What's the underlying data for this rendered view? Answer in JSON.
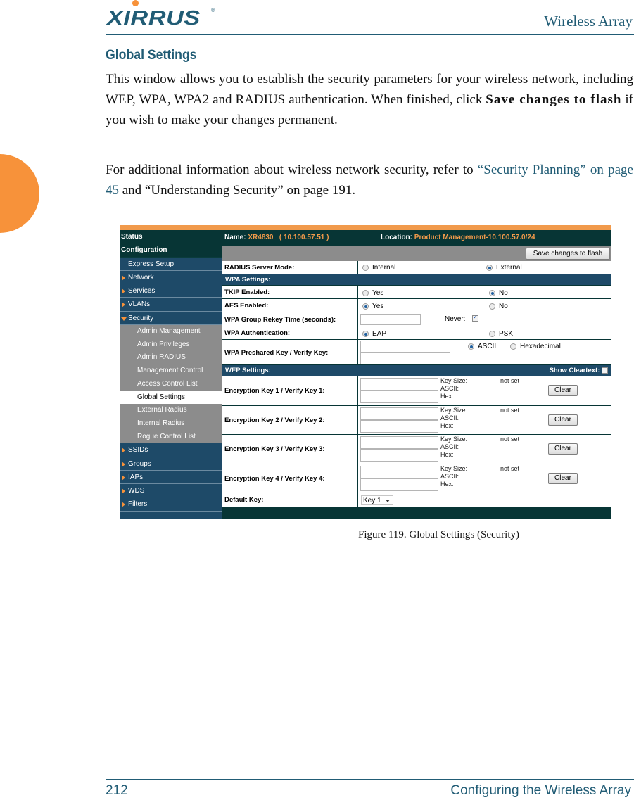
{
  "header": {
    "logo_text": "XIRRUS",
    "logo_reg": "®",
    "title": "Wireless Array"
  },
  "section": {
    "title": "Global Settings",
    "para1_a": "This window allows you to establish the security parameters for your wireless network, including WEP, WPA, WPA2 and RADIUS authentication. When finished, click ",
    "para1_bold": "Save changes to flash",
    "para1_b": " if you wish to make your changes permanent.",
    "para2_a": "For additional information about wireless network security, refer to ",
    "para2_link": "“Security Planning” on page 45",
    "para2_b": " and “Understanding Security” on page 191."
  },
  "screenshot": {
    "sidebar": {
      "status": "Status",
      "configuration": "Configuration",
      "items": [
        {
          "label": "Express Setup",
          "type": "plain"
        },
        {
          "label": "Network",
          "type": "collapsed"
        },
        {
          "label": "Services",
          "type": "collapsed"
        },
        {
          "label": "VLANs",
          "type": "collapsed"
        },
        {
          "label": "Security",
          "type": "expanded"
        }
      ],
      "security_sub": [
        {
          "label": "Admin Management",
          "active": false
        },
        {
          "label": "Admin Privileges",
          "active": false
        },
        {
          "label": "Admin RADIUS",
          "active": false
        },
        {
          "label": "Management Control",
          "active": false
        },
        {
          "label": "Access Control List",
          "active": false
        },
        {
          "label": "Global Settings",
          "active": true
        },
        {
          "label": "External Radius",
          "active": false
        },
        {
          "label": "Internal Radius",
          "active": false
        },
        {
          "label": "Rogue Control List",
          "active": false
        }
      ],
      "items_after": [
        {
          "label": "SSIDs"
        },
        {
          "label": "Groups"
        },
        {
          "label": "IAPs"
        },
        {
          "label": "WDS"
        },
        {
          "label": "Filters"
        }
      ]
    },
    "head": {
      "name_label": "Name:",
      "name_value": "XR4830",
      "ip": "( 10.100.57.51 )",
      "location_label": "Location:",
      "location_value": "Product Management-10.100.57.0/24"
    },
    "save_button": "Save changes to flash",
    "radius_mode": {
      "label": "RADIUS Server Mode:",
      "options": [
        "Internal",
        "External"
      ],
      "selected": "External"
    },
    "wpa_section": "WPA Settings:",
    "tkip": {
      "label": "TKIP Enabled:",
      "options": [
        "Yes",
        "No"
      ],
      "selected": "No"
    },
    "aes": {
      "label": "AES Enabled:",
      "options": [
        "Yes",
        "No"
      ],
      "selected": "Yes"
    },
    "rekey": {
      "label": "WPA Group Rekey Time (seconds):",
      "value": "",
      "never_label": "Never:",
      "never_checked": true
    },
    "wpa_auth": {
      "label": "WPA Authentication:",
      "options": [
        "EAP",
        "PSK"
      ],
      "selected": "EAP"
    },
    "psk": {
      "label": "WPA Preshared Key / Verify Key:",
      "key": "",
      "verify": "",
      "options": [
        "ASCII",
        "Hexadecimal"
      ],
      "selected": "ASCII"
    },
    "wep_section": "WEP Settings:",
    "show_cleartext": {
      "label": "Show Cleartext:",
      "checked": false
    },
    "wep_keys": [
      {
        "label": "Encryption Key 1 / Verify Key 1:",
        "key_size_label": "Key Size:",
        "key_size": "not set",
        "ascii_label": "ASCII:",
        "hex_label": "Hex:",
        "clear": "Clear"
      },
      {
        "label": "Encryption Key 2 / Verify Key 2:",
        "key_size_label": "Key Size:",
        "key_size": "not set",
        "ascii_label": "ASCII:",
        "hex_label": "Hex:",
        "clear": "Clear"
      },
      {
        "label": "Encryption Key 3 / Verify Key 3:",
        "key_size_label": "Key Size:",
        "key_size": "not set",
        "ascii_label": "ASCII:",
        "hex_label": "Hex:",
        "clear": "Clear"
      },
      {
        "label": "Encryption Key 4 / Verify Key 4:",
        "key_size_label": "Key Size:",
        "key_size": "not set",
        "ascii_label": "ASCII:",
        "hex_label": "Hex:",
        "clear": "Clear"
      }
    ],
    "default_key": {
      "label": "Default Key:",
      "value": "Key 1"
    }
  },
  "caption": "Figure 119. Global Settings (Security)",
  "footer": {
    "page_number": "212",
    "chapter": "Configuring the Wireless Array"
  },
  "colors": {
    "brand_blue": "#215c75",
    "brand_orange": "#f7923a",
    "ui_dark_teal": "#073535",
    "ui_nav_blue": "#1e4a68"
  }
}
